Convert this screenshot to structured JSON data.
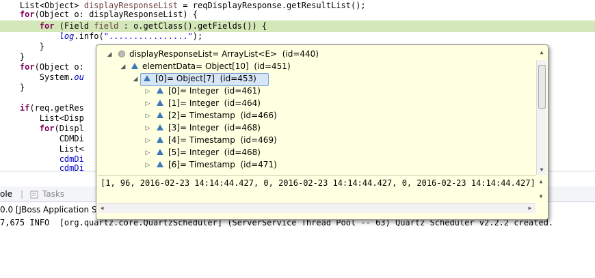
{
  "editor": {
    "lines": [
      {
        "text": "    List<Object> displayResponseList = reqDisplayResponse.getResultList();"
      },
      {
        "text": "    for(Object o: displayResponseList) {"
      },
      {
        "text": "        for (Field field : o.getClass().getFields()) {"
      },
      {
        "text": "            log.info(\"................\");"
      },
      {
        "text": "        }"
      },
      {
        "text": "    }"
      },
      {
        "text": "    for(Object o:"
      },
      {
        "text": "        System.ou"
      },
      {
        "text": "    }"
      },
      {
        "text": ""
      },
      {
        "text": "    if(req.getRes"
      },
      {
        "text": "        List<Disp"
      },
      {
        "text": "        for(Displ"
      },
      {
        "text": "            CDMDi"
      },
      {
        "text": "            List<"
      },
      {
        "text": "            cdmDi"
      },
      {
        "text": "            cdmDi"
      }
    ]
  },
  "tabs": {
    "console_label": "ole",
    "tasks_label": "Tasks"
  },
  "console": {
    "title": "0.0 [JBoss Application Serve",
    "log_line": "7,675 INFO  [org.quartz.core.QuartzScheduler] (ServerService Thread Pool -- 63) Quartz Scheduler v2.2.2 created."
  },
  "popup": {
    "root": "displayResponseList= ArrayList<E>  (id=440)",
    "element_data": "elementData= Object[10]  (id=451)",
    "selected": "[0]= Object[7]  (id=453)",
    "children": [
      "[0]= Integer  (id=461)",
      "[1]= Integer  (id=464)",
      "[2]= Timestamp  (id=466)",
      "[3]= Integer  (id=468)",
      "[4]= Timestamp  (id=469)",
      "[5]= Integer  (id=468)",
      "[6]= Timestamp  (id=471)"
    ],
    "detail": "[1, 96, 2016-02-23 14:14:44.427, 0, 2016-02-23 14:14:44.427, 0, 2016-02-23 14:14:44.427]"
  },
  "colors": {
    "highlight_line": "#d4e7b8",
    "popup_bg": "#ffffe1",
    "icon_blue": "#3b77b9"
  }
}
